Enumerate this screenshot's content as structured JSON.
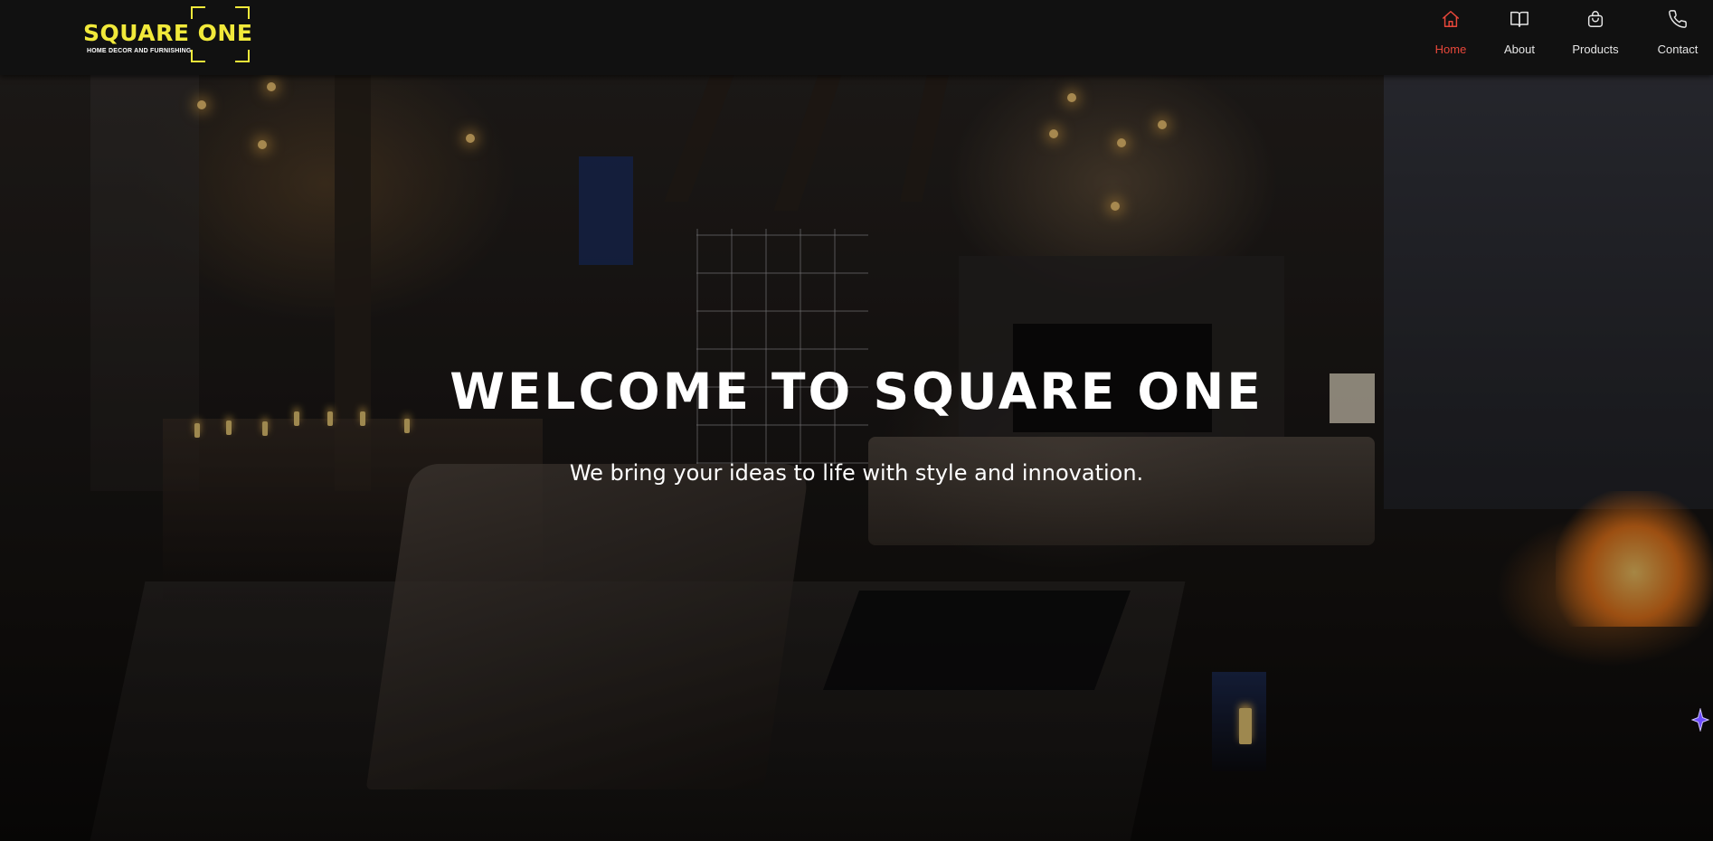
{
  "logo": {
    "name": "SQUARE ONE",
    "tagline": "HOME DECOR AND FURNISHING"
  },
  "nav": {
    "items": [
      {
        "label": "Home",
        "icon": "home-icon",
        "active": true
      },
      {
        "label": "About",
        "icon": "book-icon",
        "active": false
      },
      {
        "label": "Products",
        "icon": "shopping-bag-icon",
        "active": false
      },
      {
        "label": "Contact",
        "icon": "phone-icon",
        "active": false
      }
    ]
  },
  "hero": {
    "title": "WELCOME TO SQUARE ONE",
    "subtitle": "We bring your ideas to life with style and innovation."
  },
  "colors": {
    "brand_yellow": "#f1e93a",
    "active_red": "#e8473a",
    "nav_background": "#111111",
    "text_white": "#ffffff"
  }
}
